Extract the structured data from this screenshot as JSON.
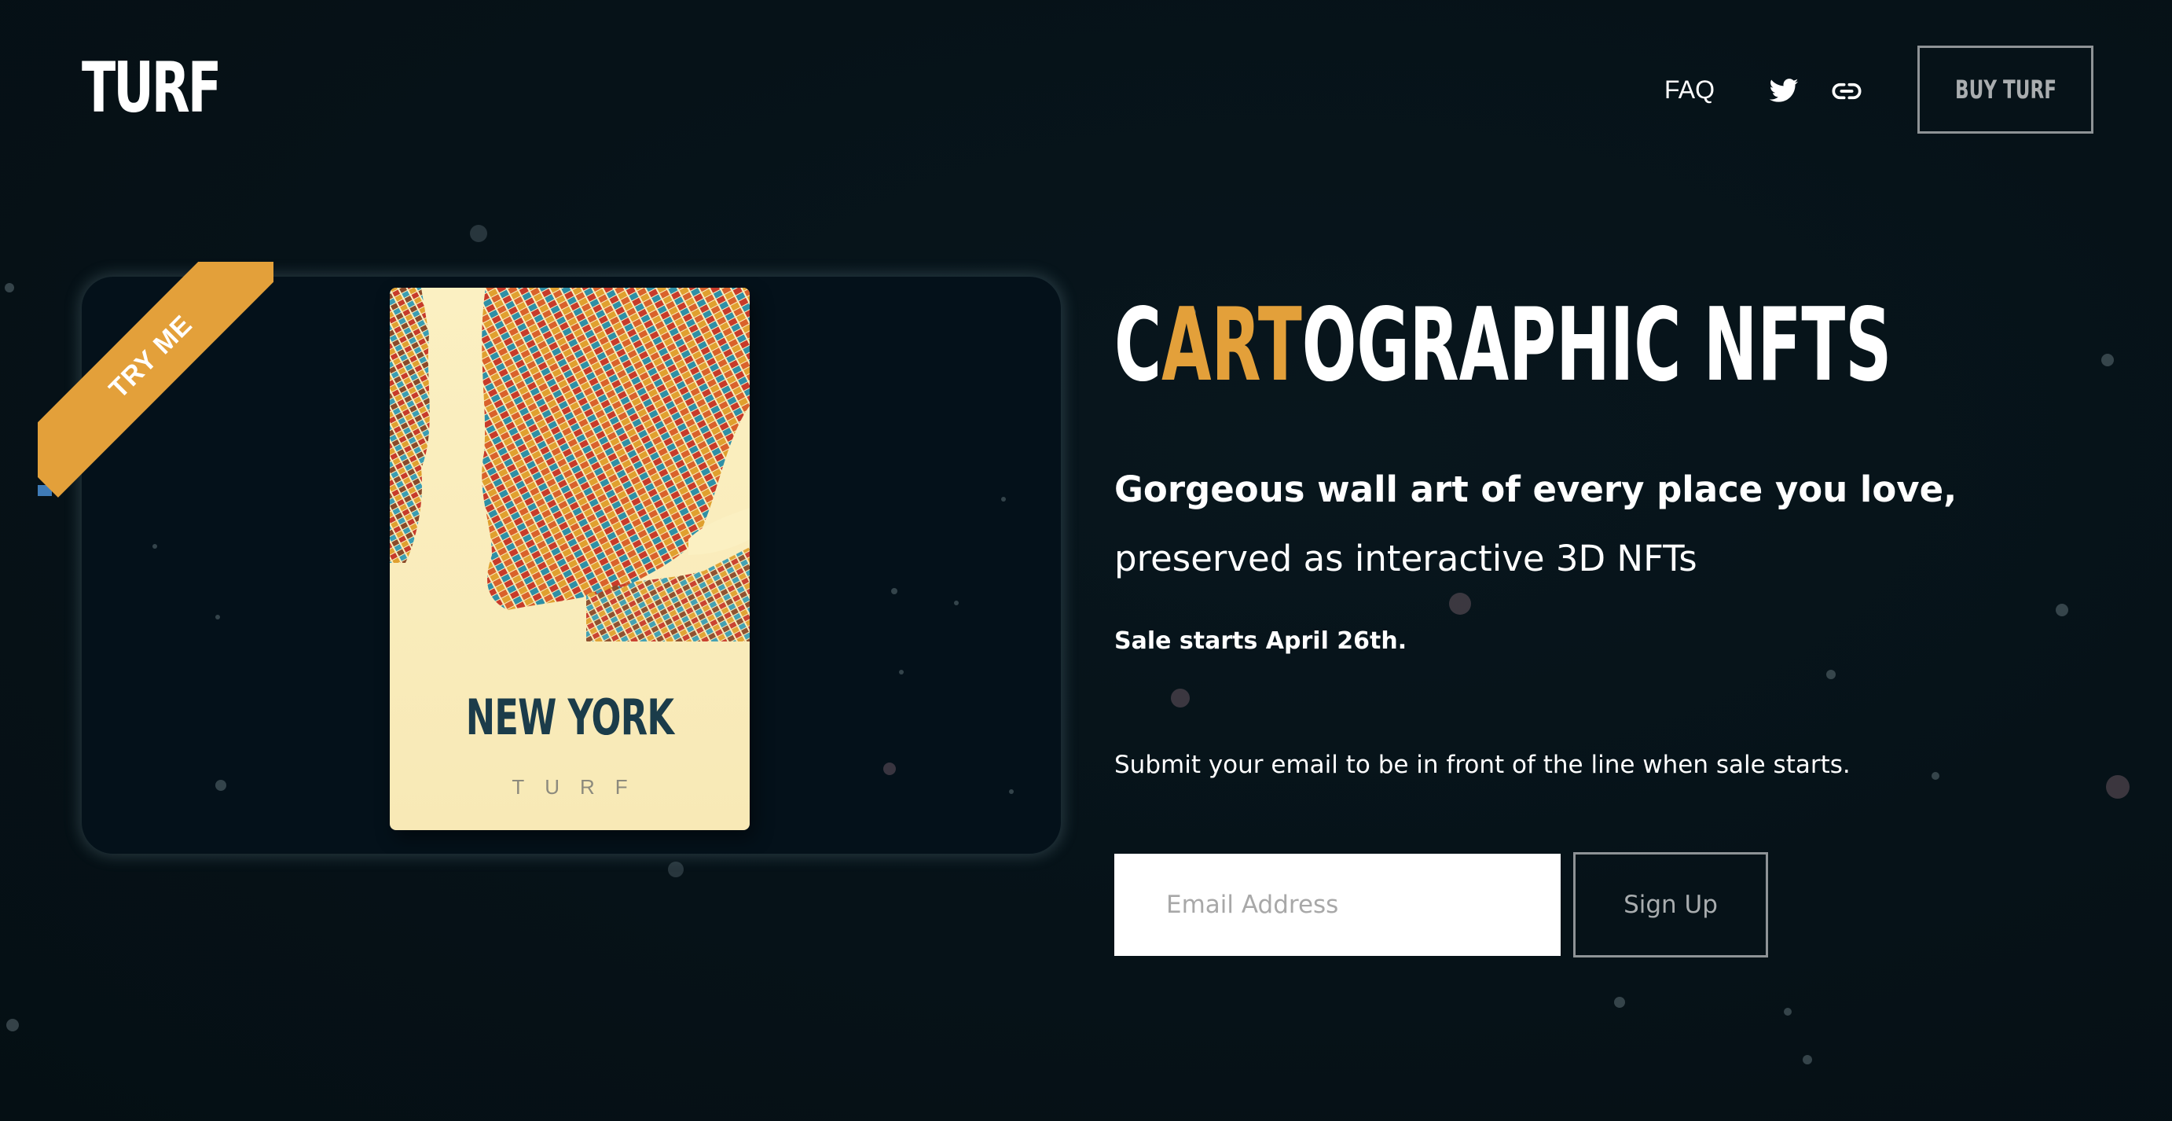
{
  "header": {
    "logo": "TURF",
    "nav_faq": "FAQ",
    "icons": [
      "twitter-icon",
      "link-icon"
    ],
    "buy_label": "BUY TURF"
  },
  "preview": {
    "ribbon_label": "TRY ME",
    "poster_city": "NEW YORK",
    "poster_brand": "TURF"
  },
  "hero": {
    "headline_start": "C",
    "headline_accent": "ART",
    "headline_end": "OGRAPHIC NFTS",
    "tagline_bold": "Gorgeous wall art of every place you love,",
    "tagline_light": "preserved as interactive 3D NFTs",
    "sale_date": "Sale starts April 26th.",
    "submit_text": "Submit your email to be in front of the line when sale starts."
  },
  "signup": {
    "email_placeholder": "Email Address",
    "button_label": "Sign Up"
  },
  "colors": {
    "background": "#061319",
    "accent": "#e3a03a",
    "ribbon_fold": "#3f7bb7",
    "poster_background": "#fbf0c2",
    "poster_title": "#1b3c4a",
    "button_border": "#8e9396"
  }
}
